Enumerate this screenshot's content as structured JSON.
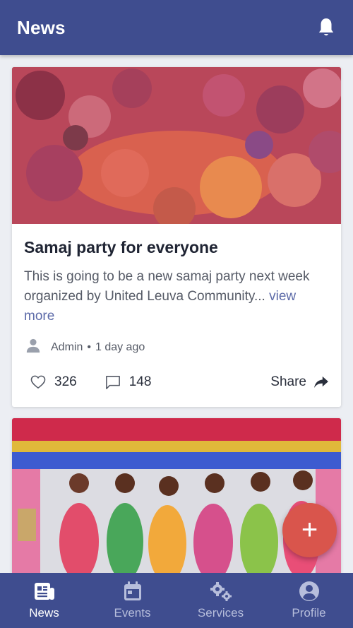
{
  "header": {
    "title": "News",
    "bell_icon": "bell-icon"
  },
  "posts": [
    {
      "title": "Samaj party for everyone",
      "excerpt": "This is going to be a new samaj party next week organized by United Leuva Community...",
      "view_more": "view more",
      "author": "Admin",
      "separator": "•",
      "time": "1 day ago",
      "likes": "326",
      "comments": "148",
      "share": "Share"
    }
  ],
  "fab": {
    "label": "+"
  },
  "bottom_nav": {
    "items": [
      {
        "label": "News",
        "icon": "news-icon",
        "active": true
      },
      {
        "label": "Events",
        "icon": "calendar-icon",
        "active": false
      },
      {
        "label": "Services",
        "icon": "gears-icon",
        "active": false
      },
      {
        "label": "Profile",
        "icon": "profile-icon",
        "active": false
      }
    ]
  },
  "colors": {
    "primary": "#3f4d8f",
    "accent": "#d9554c",
    "link": "#5c6aa8"
  }
}
